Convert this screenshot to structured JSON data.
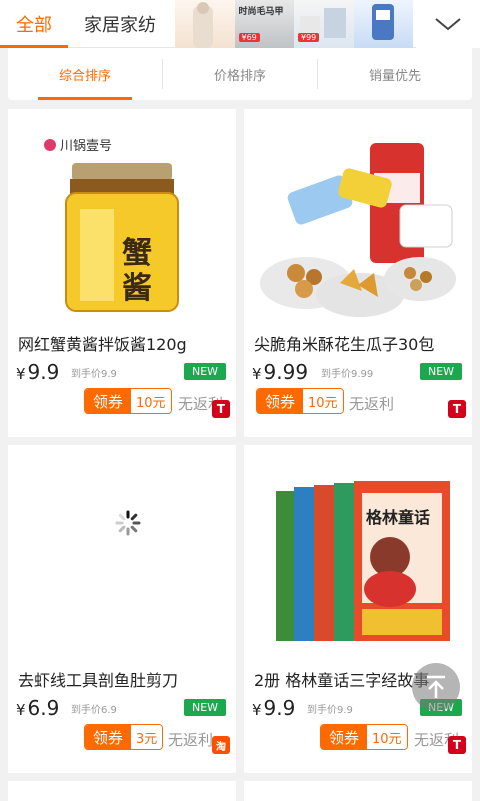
{
  "categories": {
    "active": "全部",
    "second": "家居家纺"
  },
  "banners": [
    {
      "title": "",
      "price": ""
    },
    {
      "title": "时尚毛马甲",
      "price": "¥69"
    },
    {
      "title": "",
      "price": "¥99"
    },
    {
      "title": "",
      "price": ""
    }
  ],
  "sort": {
    "tabs": [
      "综合排序",
      "价格排序",
      "销量优先"
    ],
    "active_index": 0
  },
  "products": [
    {
      "title": "网红蟹黄酱拌饭酱120g",
      "yen": "¥",
      "price": "9.9",
      "after_price": "到手价9.9",
      "badge": "NEW",
      "coupon_label": "领券",
      "coupon_amount": "10元",
      "rebate": "无返利",
      "platform": "T",
      "brand": "川锅壹号"
    },
    {
      "title": "尖脆角米酥花生瓜子30包",
      "yen": "¥",
      "price": "9.99",
      "after_price": "到手价9.99",
      "badge": "NEW",
      "coupon_label": "领券",
      "coupon_amount": "10元",
      "rebate": "无返利",
      "platform": "T"
    },
    {
      "title": "去虾线工具剖鱼肚剪刀",
      "yen": "¥",
      "price": "6.9",
      "after_price": "到手价6.9",
      "badge": "NEW",
      "coupon_label": "领券",
      "coupon_amount": "3元",
      "rebate": "无返利",
      "platform": "淘"
    },
    {
      "title": "2册 格林童话三字经故事",
      "yen": "¥",
      "price": "9.9",
      "after_price": "到手价9.9",
      "badge": "NEW",
      "coupon_label": "领券",
      "coupon_amount": "10元",
      "rebate": "无返利",
      "platform": "T"
    }
  ],
  "colors": {
    "accent": "#ff6a00",
    "new_badge": "#1ba84f",
    "tmall": "#d4001b"
  },
  "icons": {
    "expand": "chevron-down-icon",
    "back_to_top": "arrow-up-icon",
    "loading": "spinner-icon"
  }
}
